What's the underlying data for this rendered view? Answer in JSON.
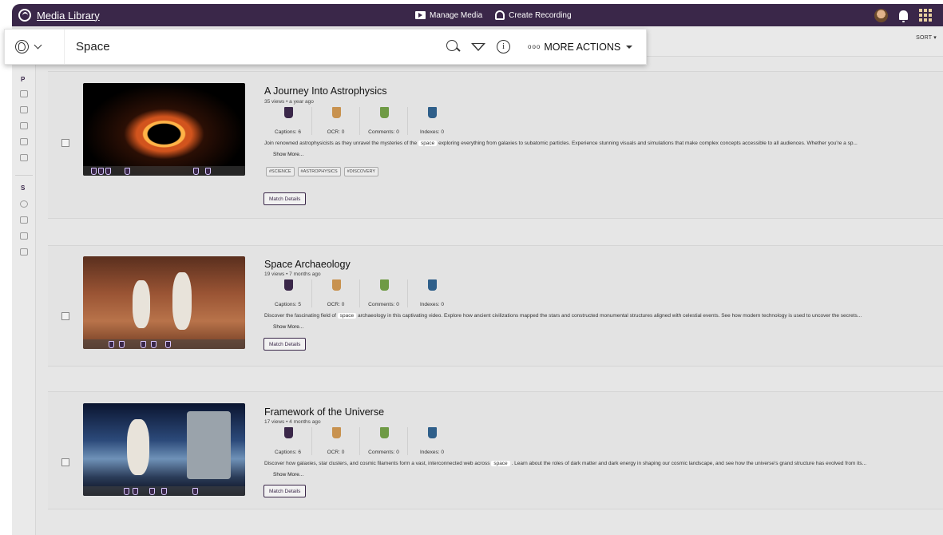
{
  "app": {
    "title": "Media Library"
  },
  "topbar": {
    "manage_media": "Manage Media",
    "create_recording": "Create Recording"
  },
  "search": {
    "value": "Space",
    "more_actions": "MORE ACTIONS"
  },
  "sort_label": "SORT",
  "sidebar": {
    "section_p": "P",
    "section_s": "S"
  },
  "colors": {
    "captions": "#3a2749",
    "ocr": "#c8924f",
    "comments": "#6f9a45",
    "indexes": "#2f5f8a",
    "accent": "#3a2749"
  },
  "results": [
    {
      "title": "A Journey Into Astrophysics",
      "meta": "35 views • a year ago",
      "captions": "Captions: 6",
      "ocr": "OCR: 0",
      "comments": "Comments: 0",
      "indexes": "Indexes: 0",
      "desc_pre": "Join renowned astrophysicists as they unravel the mysteries of the",
      "desc_hl": "space",
      "desc_post": "exploring everything from galaxies to subatomic particles. Experience stunning visuals and simulations that make complex concepts accessible to all audiences. Whether you're a sp...",
      "show_more": "Show More...",
      "tags": [
        "#SCIENCE",
        "#ASTROPHYSICS",
        "#DISCOVERY"
      ],
      "match_details": "Match Details"
    },
    {
      "title": "Space Archaeology",
      "meta": "19 views • 7 months ago",
      "captions": "Captions: 5",
      "ocr": "OCR: 0",
      "comments": "Comments: 0",
      "indexes": "Indexes: 0",
      "desc_pre": "Discover the fascinating field of",
      "desc_hl": "space",
      "desc_post": "archaeology in this captivating video. Explore how ancient civilizations mapped the stars and constructed monumental structures aligned with celestial events. See how modern technology is used to uncover the secrets...",
      "show_more": "Show More...",
      "match_details": "Match Details"
    },
    {
      "title": "Framework of the Universe",
      "meta": "17 views • 4 months ago",
      "captions": "Captions: 6",
      "ocr": "OCR: 0",
      "comments": "Comments: 0",
      "indexes": "Indexes: 0",
      "desc_pre": "Discover how galaxies, star clusters, and cosmic filaments form a vast, interconnected web across",
      "desc_hl": "space",
      "desc_post": ". Learn about the roles of dark matter and dark energy in shaping our cosmic landscape, and see how the universe's grand structure has evolved from its...",
      "show_more": "Show More...",
      "match_details": "Match Details"
    }
  ]
}
